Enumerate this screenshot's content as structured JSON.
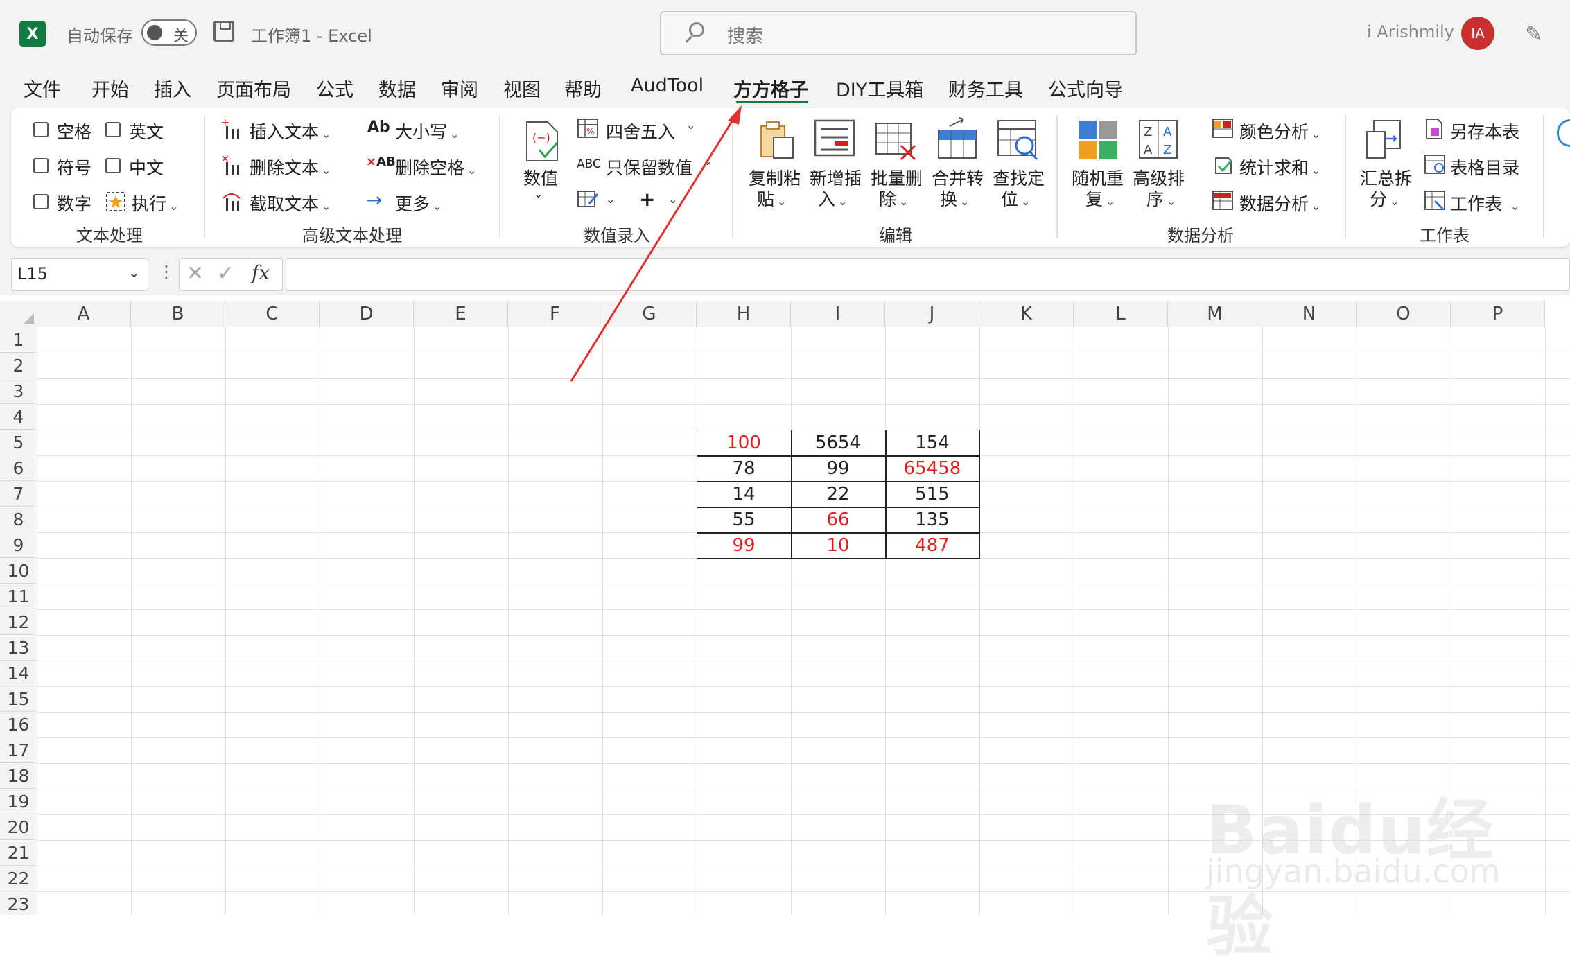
{
  "app": {
    "autosave_label": "自动保存",
    "autosave_state": "关",
    "doc_title": "工作簿1  -  Excel",
    "search_placeholder": "搜索",
    "username": "i Arishmily",
    "avatar_initials": "IA",
    "logo_letter": "X"
  },
  "menu": [
    "文件",
    "开始",
    "插入",
    "页面布局",
    "公式",
    "数据",
    "审阅",
    "视图",
    "帮助",
    "AudTool",
    "方方格子",
    "DIY工具箱",
    "财务工具",
    "公式向导"
  ],
  "menu_active": "方方格子",
  "ribbon": {
    "text_group": {
      "checkboxes": [
        "空格",
        "英文",
        "符号",
        "中文",
        "数字"
      ],
      "execute": "执行",
      "label": "文本处理"
    },
    "adv_text_group": {
      "items": [
        "插入文本",
        "删除文本",
        "截取文本",
        "大小写",
        "删除空格",
        "更多"
      ],
      "label": "高级文本处理"
    },
    "number_group": {
      "big": "数值",
      "items": [
        "四舍五入",
        "只保留数值"
      ],
      "label": "数值录入"
    },
    "edit_group": {
      "buttons": [
        {
          "l1": "复制粘",
          "l2": "贴"
        },
        {
          "l1": "新增插",
          "l2": "入"
        },
        {
          "l1": "批量删",
          "l2": "除"
        },
        {
          "l1": "合并转",
          "l2": "换"
        },
        {
          "l1": "查找定",
          "l2": "位"
        }
      ],
      "label": "编辑"
    },
    "analysis_group": {
      "buttons": [
        {
          "l1": "随机重",
          "l2": "复"
        },
        {
          "l1": "高级排",
          "l2": "序"
        }
      ],
      "items": [
        "颜色分析",
        "统计求和",
        "数据分析"
      ],
      "label": "数据分析"
    },
    "sheet_group": {
      "big": {
        "l1": "汇总拆",
        "l2": "分"
      },
      "items": [
        "另存本表",
        "表格目录",
        "工作表"
      ],
      "label": "工作表"
    }
  },
  "formula": {
    "name_box": "L15",
    "fx": "fx",
    "value": ""
  },
  "columns": [
    "A",
    "B",
    "C",
    "D",
    "E",
    "F",
    "G",
    "H",
    "I",
    "J",
    "K",
    "L",
    "M",
    "N",
    "O",
    "P"
  ],
  "rows": [
    "1",
    "2",
    "3",
    "4",
    "5",
    "6",
    "7",
    "8",
    "9",
    "10",
    "11",
    "12",
    "13",
    "14",
    "15",
    "16",
    "17",
    "18",
    "19",
    "20",
    "21",
    "22",
    "23"
  ],
  "table": [
    [
      {
        "v": "100",
        "red": true
      },
      {
        "v": "5654",
        "red": false
      },
      {
        "v": "154",
        "red": false
      }
    ],
    [
      {
        "v": "78",
        "red": false
      },
      {
        "v": "99",
        "red": false
      },
      {
        "v": "65458",
        "red": true
      }
    ],
    [
      {
        "v": "14",
        "red": false
      },
      {
        "v": "22",
        "red": false
      },
      {
        "v": "515",
        "red": false
      }
    ],
    [
      {
        "v": "55",
        "red": false
      },
      {
        "v": "66",
        "red": true
      },
      {
        "v": "135",
        "red": false
      }
    ],
    [
      {
        "v": "99",
        "red": true
      },
      {
        "v": "10",
        "red": true
      },
      {
        "v": "487",
        "red": true
      }
    ]
  ],
  "colors": {
    "accent": "#107c41",
    "red_text": "#e02020",
    "arrow": "#e03030",
    "avatar": "#c8302f"
  },
  "watermark": {
    "brand": "Baidu经验",
    "url": "jingyan.baidu.com"
  }
}
